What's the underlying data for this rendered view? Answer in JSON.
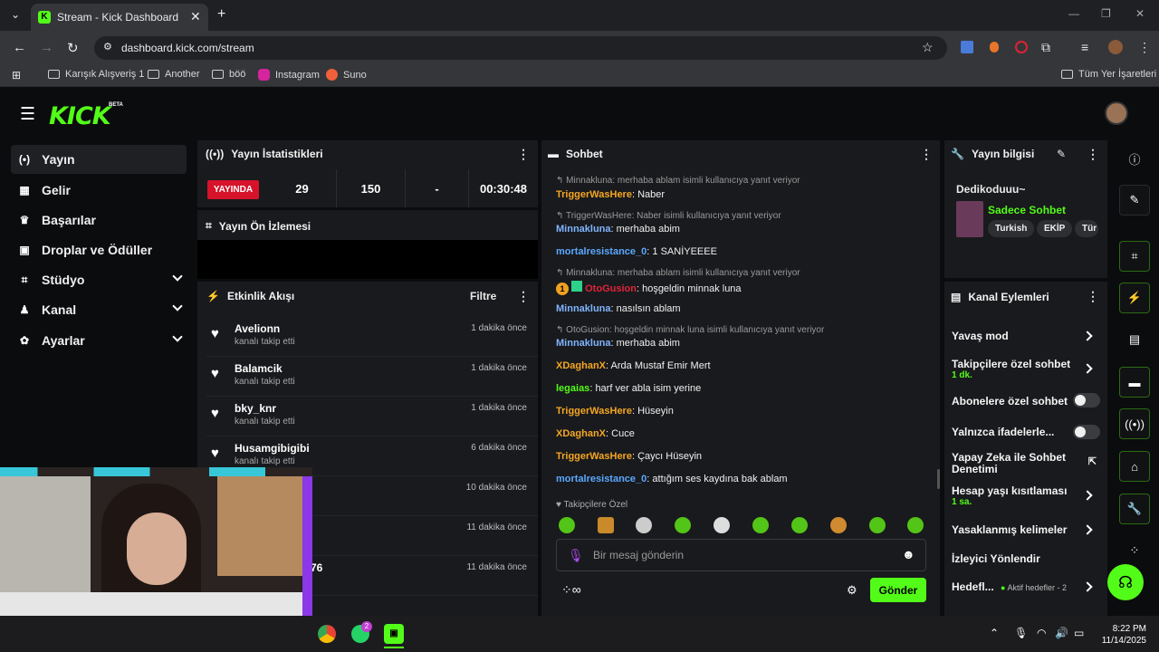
{
  "browser": {
    "tab_title": "Stream - Kick Dashboard",
    "url": "dashboard.kick.com/stream",
    "bookmarks": [
      "Karışık Alışveriş 1",
      "Another",
      "böö",
      "Instagram",
      "Suno"
    ],
    "all_bookmarks": "Tüm Yer İşaretleri"
  },
  "brand": {
    "logo": "KICK",
    "beta": "BETA",
    "accent": "#53fc18"
  },
  "sidebar": {
    "items": [
      {
        "label": "Yayın",
        "icon": "broadcast-icon"
      },
      {
        "label": "Gelir",
        "icon": "chart-icon"
      },
      {
        "label": "Başarılar",
        "icon": "trophy-icon"
      },
      {
        "label": "Droplar ve Ödüller",
        "icon": "gift-icon"
      },
      {
        "label": "Stüdyo",
        "icon": "studio-icon"
      },
      {
        "label": "Kanal",
        "icon": "channel-icon"
      },
      {
        "label": "Ayarlar",
        "icon": "gear-icon"
      }
    ]
  },
  "stats": {
    "title": "Yayın İstatistikleri",
    "live_badge": "YAYINDA",
    "values": [
      "29",
      "150",
      "-",
      "00:30:48"
    ]
  },
  "preview": {
    "title": "Yayın Ön İzlemesi"
  },
  "activity": {
    "title": "Etkinlik Akışı",
    "filter": "Filtre",
    "items": [
      {
        "name": "Avelionn",
        "sub": "kanalı takip etti",
        "time": "1 dakika önce"
      },
      {
        "name": "Balamcik",
        "sub": "kanalı takip etti",
        "time": "1 dakika önce"
      },
      {
        "name": "bky_knr",
        "sub": "kanalı takip etti",
        "time": "1 dakika önce"
      },
      {
        "name": "Husamgibigibi",
        "sub": "kanalı takip etti",
        "time": "6 dakika önce"
      },
      {
        "name": "",
        "sub": "",
        "time": "10 dakika önce"
      },
      {
        "name": "",
        "sub": "",
        "time": "11 dakika önce"
      },
      {
        "name": "76",
        "sub": "",
        "time": "11 dakika önce"
      }
    ]
  },
  "chat": {
    "title": "Sohbet",
    "lines": [
      {
        "type": "reply",
        "text": "Minnakluna: merhaba ablam isimli kullanıcıya yanıt veriyor"
      },
      {
        "type": "msg",
        "user": "TriggerWasHere",
        "color": "#f5a623",
        "text": "Naber"
      },
      {
        "type": "reply",
        "text": "TriggerWasHere: Naber isimli kullanıcıya yanıt veriyor"
      },
      {
        "type": "msg",
        "user": "Minnakluna",
        "color": "#7fb4ff",
        "text": "merhaba abim"
      },
      {
        "type": "msg",
        "user": "mortalresistance_0",
        "color": "#5aa8ff",
        "text": "1 SANİYEEEE"
      },
      {
        "type": "reply",
        "text": "Minnakluna: merhaba ablam isimli kullanıcıya yanıt veriyor"
      },
      {
        "type": "msg",
        "user": "OtoGusion",
        "color": "#e0243a",
        "text": "hoşgeldin minnak luna"
      },
      {
        "type": "msg",
        "user": "Minnakluna",
        "color": "#7fb4ff",
        "text": "nasılsın ablam"
      },
      {
        "type": "reply",
        "text": "OtoGusion: hoşgeldin minnak luna isimli kullanıcıya yanıt veriyor"
      },
      {
        "type": "msg",
        "user": "Minnakluna",
        "color": "#7fb4ff",
        "text": "merhaba abim"
      },
      {
        "type": "msg",
        "user": "XDaghanX",
        "color": "#f5a623",
        "text": "Arda Mustaf Emir Mert"
      },
      {
        "type": "msg",
        "user": "legaias",
        "color": "#53fc18",
        "text": "harf ver abla isim yerine"
      },
      {
        "type": "msg",
        "user": "TriggerWasHere",
        "color": "#f5a623",
        "text": "Hüseyin"
      },
      {
        "type": "msg",
        "user": "XDaghanX",
        "color": "#f5a623",
        "text": "Cuce"
      },
      {
        "type": "msg",
        "user": "TriggerWasHere",
        "color": "#f5a623",
        "text": "Çaycı Hüseyin"
      },
      {
        "type": "msg",
        "user": "mortalresistance_0",
        "color": "#5aa8ff",
        "text": "attığım ses kaydına bak ablam"
      }
    ],
    "followers_only": "Takipçilere Özel",
    "placeholder": "Bir mesaj gönderin",
    "send": "Gönder",
    "badge_number": "1"
  },
  "stream_info": {
    "title": "Yayın bilgisi",
    "stream_title": "Dedikoduuu~",
    "category": "Sadece Sohbet",
    "tags": [
      "Turkish",
      "EKİP",
      "Tür"
    ]
  },
  "channel_actions": {
    "title": "Kanal Eylemleri",
    "slow_mode": "Yavaş mod",
    "followers_chat": "Takipçilere özel sohbet",
    "followers_chat_value": "1 dk.",
    "subs_chat": "Abonelere özel sohbet",
    "emotes_only": "Yalnızca ifadelerle...",
    "ai_moderation_1": "Yapay Zeka ile Sohbet",
    "ai_moderation_2": "Denetimi",
    "account_age": "Hesap yaşı kısıtlaması",
    "account_age_value": "1 sa.",
    "banned_words": "Yasaklanmış kelimeler",
    "redirect": "İzleyici Yönlendir",
    "goals": "Hedefl...",
    "goals_status": "Aktif hedefler - 2"
  },
  "taskbar": {
    "time": "8:22 PM",
    "date": "11/14/2025",
    "whatsapp_badge": "2"
  }
}
